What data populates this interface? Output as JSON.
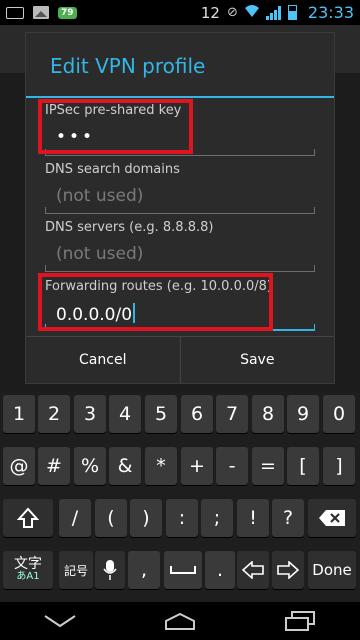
{
  "status_bar": {
    "battery_badge": "79",
    "notification_count": "12",
    "time": "23:33"
  },
  "dialog": {
    "title": "Edit VPN profile",
    "fields": [
      {
        "label": "IPSec pre-shared key",
        "value": "•••",
        "is_hint": false
      },
      {
        "label": "DNS search domains",
        "value": "(not used)",
        "is_hint": true
      },
      {
        "label": "DNS servers (e.g. 8.8.8.8)",
        "value": "(not used)",
        "is_hint": true
      },
      {
        "label": "Forwarding routes (e.g. 10.0.0.0/8)",
        "value": "0.0.0.0/0",
        "is_hint": false
      }
    ],
    "cancel_label": "Cancel",
    "save_label": "Save"
  },
  "keyboard": {
    "row1": [
      "1",
      "2",
      "3",
      "4",
      "5",
      "6",
      "7",
      "8",
      "9",
      "0"
    ],
    "row2": [
      "@",
      "#",
      "%",
      "&",
      "*",
      "+",
      "-",
      "=",
      "[",
      "]"
    ],
    "row3": [
      "/",
      "(",
      ")",
      ":",
      ";",
      "!",
      "?"
    ],
    "row4": {
      "lang_top": "文字",
      "lang_bottom": "あA1",
      "symbols": "記号",
      "comma": ",",
      "period": ".",
      "done": "Done"
    }
  },
  "icons": {
    "status": [
      "keyboard-icon",
      "image-icon",
      "battery-badge",
      "mute-icon",
      "wifi-icon",
      "signal-icon",
      "battery-icon"
    ],
    "keyboard": [
      "shift-icon",
      "backspace-icon",
      "mic-icon",
      "space-icon",
      "arrow-left-icon",
      "arrow-right-icon"
    ],
    "nav": [
      "back-icon",
      "home-icon",
      "recent-apps-icon"
    ]
  },
  "colors": {
    "accent": "#33b5e5",
    "highlight": "#e0141f",
    "dialog_bg": "#2b2b2b"
  }
}
